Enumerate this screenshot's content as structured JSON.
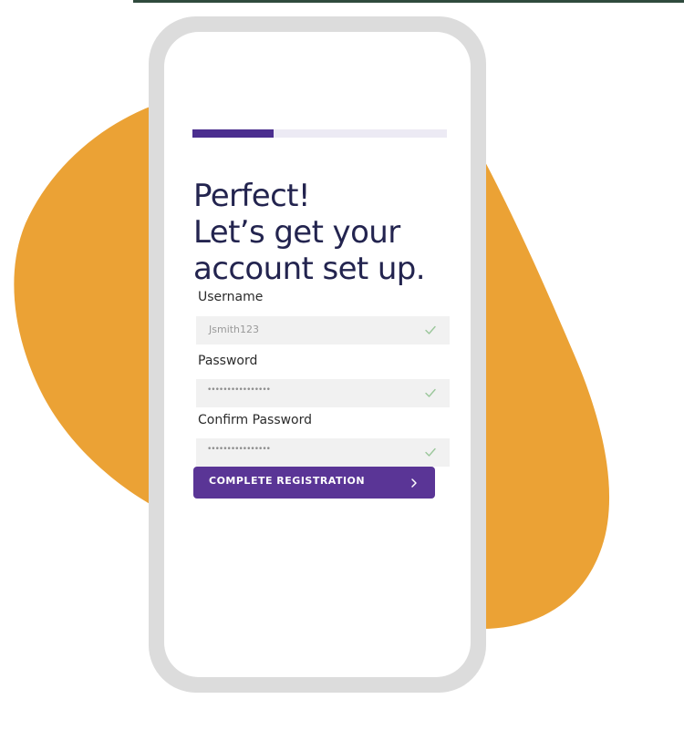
{
  "progress": {
    "fraction": 0.32,
    "fill_color": "#4b2e8f",
    "track_color": "#eceaf4"
  },
  "headline": {
    "line1": "Perfect!",
    "line2": "Let’s get your",
    "line3": "account set up."
  },
  "form": {
    "username": {
      "label": "Username",
      "value": "Jsmith123",
      "icon": "check-icon"
    },
    "password": {
      "label": "Password",
      "value": "••••••••••••••••",
      "icon": "check-icon"
    },
    "confirm_password": {
      "label": "Confirm Password",
      "value": "••••••••••••••••",
      "icon": "check-icon"
    }
  },
  "cta": {
    "label": "COMPLETE REGISTRATION",
    "icon": "chevron-right-icon",
    "color": "#5a3596"
  },
  "colors": {
    "blob": "#eba235",
    "headline": "#23244f",
    "phone_frame": "#dcdcdc",
    "check": "#9bc79b"
  }
}
